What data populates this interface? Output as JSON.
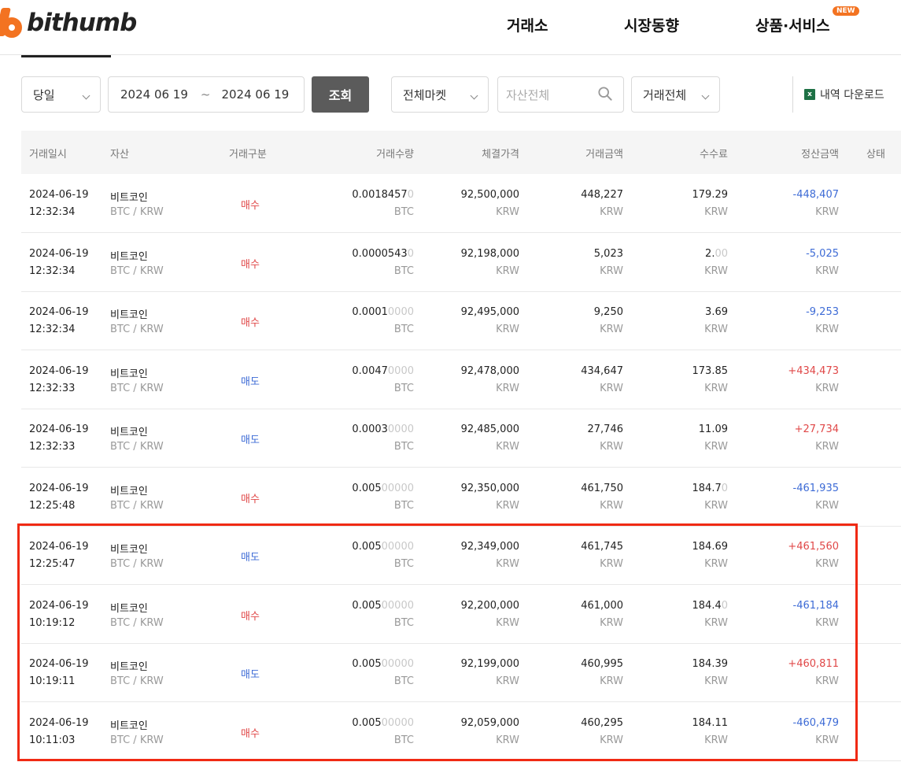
{
  "header": {
    "logo_text": "bithumb",
    "nav": [
      "거래소",
      "시장동향",
      "상품·서비스"
    ],
    "new_badge": "NEW"
  },
  "filters": {
    "period": "당일",
    "date_from": "2024 06 19",
    "date_sep": "~",
    "date_to": "2024 06 19",
    "query_button": "조회",
    "market": "전체마켓",
    "asset_placeholder": "자산전체",
    "trade_type": "거래전체",
    "download": "내역 다운로드"
  },
  "table": {
    "headers": [
      "거래일시",
      "자산",
      "거래구분",
      "거래수량",
      "체결가격",
      "거래금액",
      "수수료",
      "정산금액",
      "상태"
    ],
    "rows": [
      {
        "date": "2024-06-19",
        "time": "12:32:34",
        "asset": "비트코인",
        "pair": "BTC / KRW",
        "type": "매수",
        "side": "buy",
        "qty": "0.0018457",
        "qty_tail": "0",
        "qty_unit": "BTC",
        "price": "92,500,000",
        "price_unit": "KRW",
        "amount": "448,227",
        "amount_unit": "KRW",
        "fee": "179.29",
        "fee_tail": "",
        "fee_unit": "KRW",
        "settle": "-448,407",
        "settle_unit": "KRW",
        "settle_sign": "neg"
      },
      {
        "date": "2024-06-19",
        "time": "12:32:34",
        "asset": "비트코인",
        "pair": "BTC / KRW",
        "type": "매수",
        "side": "buy",
        "qty": "0.0000543",
        "qty_tail": "0",
        "qty_unit": "BTC",
        "price": "92,198,000",
        "price_unit": "KRW",
        "amount": "5,023",
        "amount_unit": "KRW",
        "fee": "2.",
        "fee_tail": "00",
        "fee_unit": "KRW",
        "settle": "-5,025",
        "settle_unit": "KRW",
        "settle_sign": "neg"
      },
      {
        "date": "2024-06-19",
        "time": "12:32:34",
        "asset": "비트코인",
        "pair": "BTC / KRW",
        "type": "매수",
        "side": "buy",
        "qty": "0.0001",
        "qty_tail": "0000",
        "qty_unit": "BTC",
        "price": "92,495,000",
        "price_unit": "KRW",
        "amount": "9,250",
        "amount_unit": "KRW",
        "fee": "3.69",
        "fee_tail": "",
        "fee_unit": "KRW",
        "settle": "-9,253",
        "settle_unit": "KRW",
        "settle_sign": "neg"
      },
      {
        "date": "2024-06-19",
        "time": "12:32:33",
        "asset": "비트코인",
        "pair": "BTC / KRW",
        "type": "매도",
        "side": "sell",
        "qty": "0.0047",
        "qty_tail": "0000",
        "qty_unit": "BTC",
        "price": "92,478,000",
        "price_unit": "KRW",
        "amount": "434,647",
        "amount_unit": "KRW",
        "fee": "173.85",
        "fee_tail": "",
        "fee_unit": "KRW",
        "settle": "+434,473",
        "settle_unit": "KRW",
        "settle_sign": "pos"
      },
      {
        "date": "2024-06-19",
        "time": "12:32:33",
        "asset": "비트코인",
        "pair": "BTC / KRW",
        "type": "매도",
        "side": "sell",
        "qty": "0.0003",
        "qty_tail": "0000",
        "qty_unit": "BTC",
        "price": "92,485,000",
        "price_unit": "KRW",
        "amount": "27,746",
        "amount_unit": "KRW",
        "fee": "11.09",
        "fee_tail": "",
        "fee_unit": "KRW",
        "settle": "+27,734",
        "settle_unit": "KRW",
        "settle_sign": "pos"
      },
      {
        "date": "2024-06-19",
        "time": "12:25:48",
        "asset": "비트코인",
        "pair": "BTC / KRW",
        "type": "매수",
        "side": "buy",
        "qty": "0.005",
        "qty_tail": "00000",
        "qty_unit": "BTC",
        "price": "92,350,000",
        "price_unit": "KRW",
        "amount": "461,750",
        "amount_unit": "KRW",
        "fee": "184.7",
        "fee_tail": "0",
        "fee_unit": "KRW",
        "settle": "-461,935",
        "settle_unit": "KRW",
        "settle_sign": "neg"
      },
      {
        "date": "2024-06-19",
        "time": "12:25:47",
        "asset": "비트코인",
        "pair": "BTC / KRW",
        "type": "매도",
        "side": "sell",
        "qty": "0.005",
        "qty_tail": "00000",
        "qty_unit": "BTC",
        "price": "92,349,000",
        "price_unit": "KRW",
        "amount": "461,745",
        "amount_unit": "KRW",
        "fee": "184.69",
        "fee_tail": "",
        "fee_unit": "KRW",
        "settle": "+461,560",
        "settle_unit": "KRW",
        "settle_sign": "pos"
      },
      {
        "date": "2024-06-19",
        "time": "10:19:12",
        "asset": "비트코인",
        "pair": "BTC / KRW",
        "type": "매수",
        "side": "buy",
        "qty": "0.005",
        "qty_tail": "00000",
        "qty_unit": "BTC",
        "price": "92,200,000",
        "price_unit": "KRW",
        "amount": "461,000",
        "amount_unit": "KRW",
        "fee": "184.4",
        "fee_tail": "0",
        "fee_unit": "KRW",
        "settle": "-461,184",
        "settle_unit": "KRW",
        "settle_sign": "neg"
      },
      {
        "date": "2024-06-19",
        "time": "10:19:11",
        "asset": "비트코인",
        "pair": "BTC / KRW",
        "type": "매도",
        "side": "sell",
        "qty": "0.005",
        "qty_tail": "00000",
        "qty_unit": "BTC",
        "price": "92,199,000",
        "price_unit": "KRW",
        "amount": "460,995",
        "amount_unit": "KRW",
        "fee": "184.39",
        "fee_tail": "",
        "fee_unit": "KRW",
        "settle": "+460,811",
        "settle_unit": "KRW",
        "settle_sign": "pos"
      },
      {
        "date": "2024-06-19",
        "time": "10:11:03",
        "asset": "비트코인",
        "pair": "BTC / KRW",
        "type": "매수",
        "side": "buy",
        "qty": "0.005",
        "qty_tail": "00000",
        "qty_unit": "BTC",
        "price": "92,059,000",
        "price_unit": "KRW",
        "amount": "460,295",
        "amount_unit": "KRW",
        "fee": "184.11",
        "fee_tail": "",
        "fee_unit": "KRW",
        "settle": "-460,479",
        "settle_unit": "KRW",
        "settle_sign": "neg"
      }
    ]
  },
  "colors": {
    "brand": "#f37321",
    "buy": "#e04848",
    "sell": "#3d6bd6",
    "highlight": "#f02a14"
  }
}
